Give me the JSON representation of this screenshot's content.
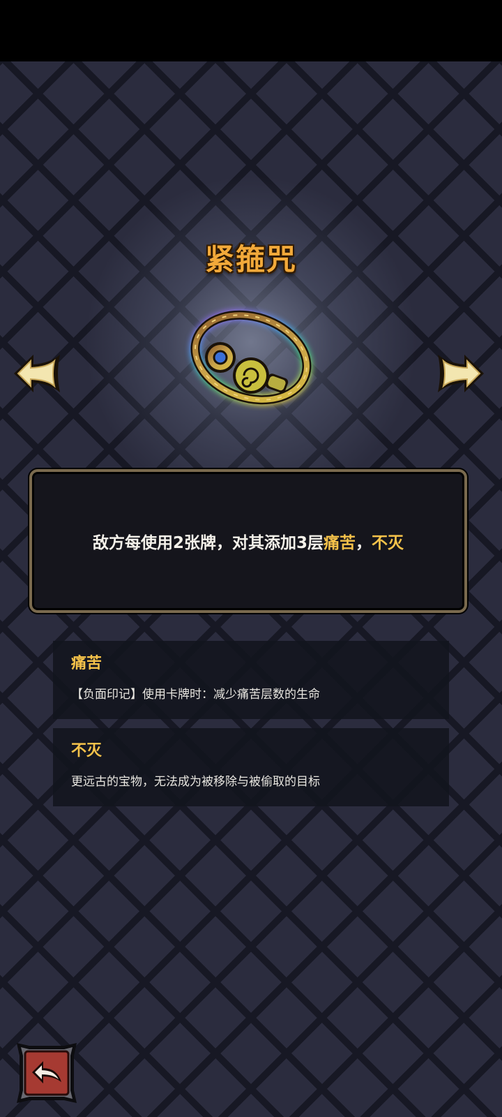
{
  "item": {
    "name": "紧箍咒",
    "description_parts": [
      "敌方每使用2张牌，对其添加3层",
      "痛苦",
      "，",
      "不灭"
    ]
  },
  "keywords": [
    {
      "title": "痛苦",
      "description": "【负面印记】使用卡牌时：减少痛苦层数的生命"
    },
    {
      "title": "不灭",
      "description": "更远古的宝物，无法成为被移除与被偷取的目标"
    }
  ],
  "icons": {
    "prev": "left-arrow-icon",
    "next": "right-arrow-icon",
    "back": "return-arrow-icon",
    "item_art": "golden-headband-ring-icon"
  },
  "colors": {
    "title": "#f2a93a",
    "highlight": "#f5c24a",
    "panel_border": "#7a6a4e",
    "back_button": "#a63a32"
  }
}
